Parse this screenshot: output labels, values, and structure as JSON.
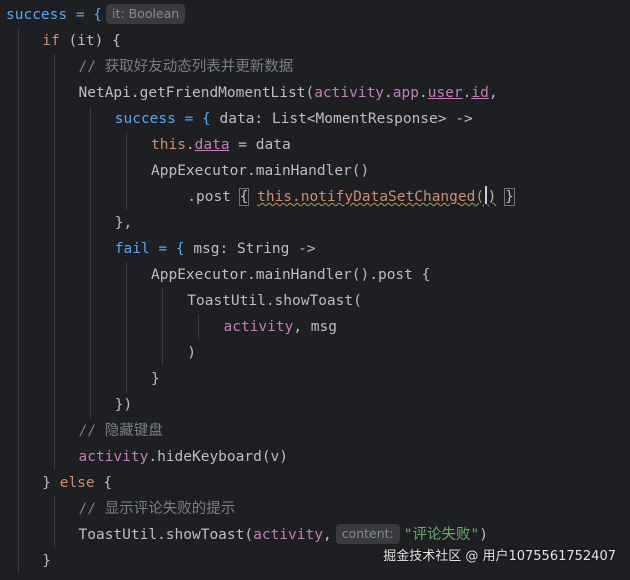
{
  "code": {
    "lines": [
      [
        {
          "t": "success = {",
          "c": "fn"
        },
        {
          "hint": "it: Boolean"
        }
      ],
      [
        {
          "t": "if",
          "c": "kw"
        },
        {
          "t": " (it) {",
          "c": "plain"
        }
      ],
      [
        {
          "t": "// 获取好友动态列表并更新数据",
          "c": "cmt"
        }
      ],
      [
        {
          "t": "NetApi.getFriendMomentList(",
          "c": "plain"
        },
        {
          "t": "activity",
          "c": "param"
        },
        {
          "t": ".",
          "c": "plain"
        },
        {
          "t": "app",
          "c": "prop"
        },
        {
          "t": ".",
          "c": "plain"
        },
        {
          "t": "user",
          "c": "prop underline"
        },
        {
          "t": ".",
          "c": "plain"
        },
        {
          "t": "id",
          "c": "prop underline"
        },
        {
          "t": ",",
          "c": "plain"
        }
      ],
      [
        {
          "t": "success = {",
          "c": "fn"
        },
        {
          "t": " data: List<MomentResponse> ->",
          "c": "plain"
        }
      ],
      [
        {
          "t": "this",
          "c": "kw"
        },
        {
          "t": ".",
          "c": "plain"
        },
        {
          "t": "data",
          "c": "prop underline"
        },
        {
          "t": " = data",
          "c": "plain"
        }
      ],
      [
        {
          "t": "AppExecutor.mainHandler()",
          "c": "plain"
        }
      ],
      [
        {
          "t": ".post ",
          "c": "plain"
        },
        {
          "t": "{",
          "c": "plain brace-hl"
        },
        {
          "t": " ",
          "c": "plain"
        },
        {
          "t": "this.notifyDataSetChanged(",
          "c": "kw warn"
        },
        {
          "caret": true
        },
        {
          "t": ")",
          "c": "plain warn"
        },
        {
          "t": " ",
          "c": "plain"
        },
        {
          "t": "}",
          "c": "plain brace-hl"
        }
      ],
      [
        {
          "t": "},",
          "c": "plain"
        }
      ],
      [
        {
          "t": "fail = {",
          "c": "fn"
        },
        {
          "t": " msg: String ->",
          "c": "plain"
        }
      ],
      [
        {
          "t": "AppExecutor.mainHandler().post {",
          "c": "plain"
        }
      ],
      [
        {
          "t": "ToastUtil.showToast(",
          "c": "plain"
        }
      ],
      [
        {
          "t": "activity",
          "c": "param"
        },
        {
          "t": ", msg",
          "c": "plain"
        }
      ],
      [
        {
          "t": ")",
          "c": "plain"
        }
      ],
      [
        {
          "t": "}",
          "c": "plain"
        }
      ],
      [
        {
          "t": "})",
          "c": "plain"
        }
      ],
      [
        {
          "t": "// 隐藏键盘",
          "c": "cmt"
        }
      ],
      [
        {
          "t": "activity",
          "c": "param"
        },
        {
          "t": ".hideKeyboard(v)",
          "c": "plain"
        }
      ],
      [
        {
          "t": "} ",
          "c": "plain"
        },
        {
          "t": "else",
          "c": "kw"
        },
        {
          "t": " {",
          "c": "plain"
        }
      ],
      [
        {
          "t": "// 显示评论失败的提示",
          "c": "cmt"
        }
      ],
      [
        {
          "t": "ToastUtil.showToast(",
          "c": "plain"
        },
        {
          "t": "activity",
          "c": "param"
        },
        {
          "t": ",",
          "c": "plain"
        },
        {
          "hint": "content:"
        },
        {
          "t": "\"评论失败\"",
          "c": "str"
        },
        {
          "t": ")",
          "c": "plain"
        }
      ],
      [
        {
          "t": "}",
          "c": "plain"
        }
      ]
    ]
  },
  "watermark": "掘金技术社区 @ 用户1075561752407",
  "colors": {
    "background": "#1e1f22",
    "keyword": "#cf8e6d",
    "function": "#56a8f5",
    "property": "#c77dbb",
    "string": "#6aab73",
    "comment": "#7a7e85",
    "text": "#bcbec4"
  }
}
